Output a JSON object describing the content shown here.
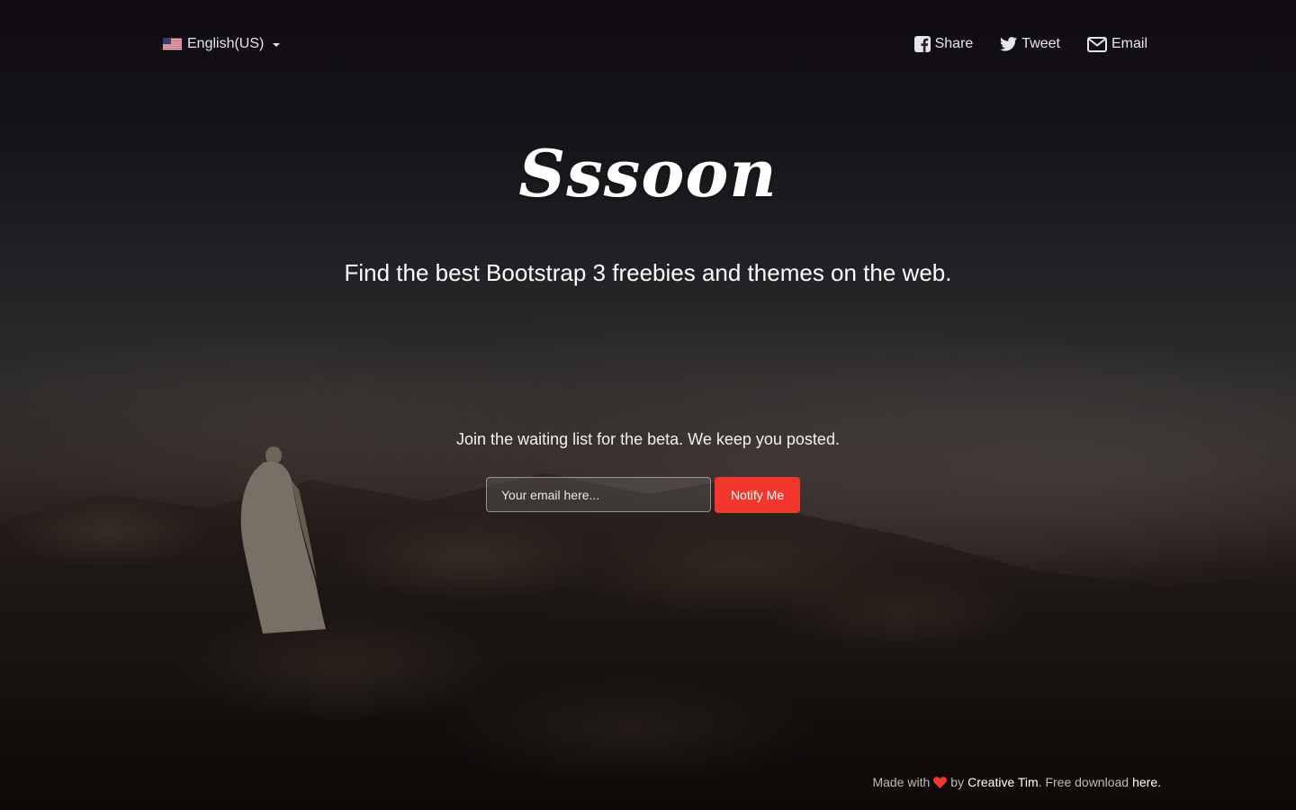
{
  "language": {
    "label": "English(US)",
    "flag_icon": "us-flag-icon"
  },
  "social": [
    {
      "label": "Share",
      "icon": "facebook-icon"
    },
    {
      "label": "Tweet",
      "icon": "twitter-icon"
    },
    {
      "label": "Email",
      "icon": "envelope-icon"
    }
  ],
  "logo": "Sssoon",
  "tagline": "Find the best Bootstrap 3 freebies and themes on the web.",
  "signup": {
    "prompt": "Join the waiting list for the beta. We keep you posted.",
    "email_placeholder": "Your email here...",
    "button_label": "Notify Me"
  },
  "footer": {
    "made_with": "Made with",
    "by": "by",
    "author_link": "Creative Tim",
    "free_download": ". Free download",
    "here_link": "here."
  },
  "colors": {
    "accent": "#f3372d",
    "heart": "#f3372d"
  }
}
